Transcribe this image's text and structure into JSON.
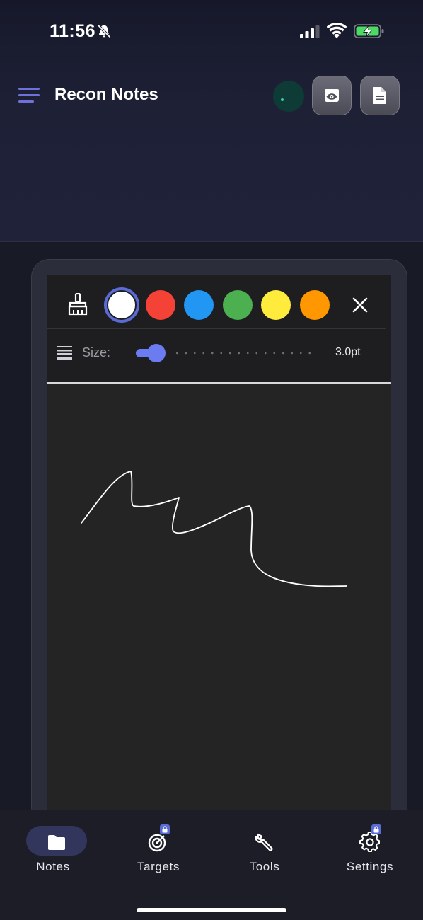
{
  "status_bar": {
    "time": "11:56"
  },
  "header": {
    "title": "Recon Notes",
    "icons": [
      "menu-icon",
      "sync-indicator",
      "eye-icon",
      "document-icon"
    ]
  },
  "toolbar": {
    "colors": [
      {
        "name": "white",
        "hex": "#ffffff",
        "selected": true
      },
      {
        "name": "red",
        "hex": "#f44336"
      },
      {
        "name": "blue",
        "hex": "#2196f3"
      },
      {
        "name": "green",
        "hex": "#4caf50"
      },
      {
        "name": "yellow",
        "hex": "#ffeb3b"
      },
      {
        "name": "orange",
        "hex": "#ff9800"
      }
    ],
    "size_label": "Size:",
    "size_value": "3.0pt",
    "slider_level": 0.05,
    "accent": "#6b7bf0"
  },
  "tabs": [
    {
      "label": "Notes",
      "icon": "folder-icon",
      "active": true
    },
    {
      "label": "Targets",
      "icon": "target-icon",
      "locked": true
    },
    {
      "label": "Tools",
      "icon": "wrench-icon"
    },
    {
      "label": "Settings",
      "icon": "gear-icon",
      "locked": true
    }
  ]
}
